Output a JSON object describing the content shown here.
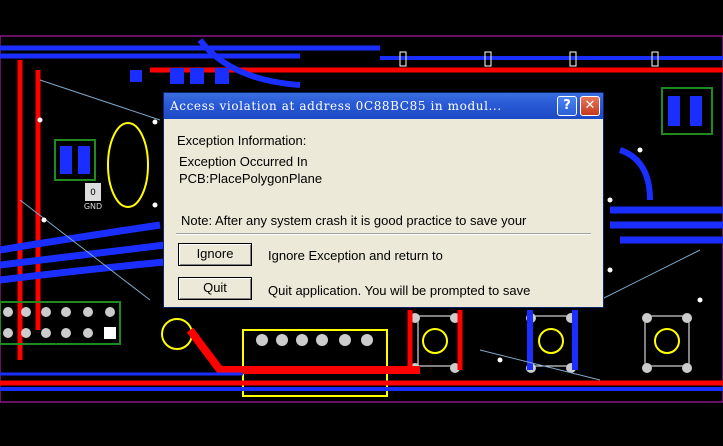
{
  "background": {
    "pcb_label_zero": "0",
    "pcb_label_gnd": "GND"
  },
  "dialog": {
    "title": "Access violation at address 0C88BC85 in modul...",
    "help_label": "?",
    "close_label": "✕",
    "heading": "Exception Information:",
    "occurred_line1": "Exception Occurred In",
    "occurred_line2": "PCB:PlacePolygonPlane",
    "note": "Note: After any system crash it is good practice to save your",
    "ignore_label": "Ignore",
    "ignore_desc": "Ignore Exception and return to",
    "quit_label": "Quit",
    "quit_desc": "Quit application. You will be prompted to save"
  },
  "colors": {
    "title_bar": "#2a5bd6",
    "dialog_bg": "#ece9d8",
    "trace_red": "#ff0000",
    "trace_blue": "#1a2fff",
    "silkscreen_yellow": "#ffff00"
  }
}
